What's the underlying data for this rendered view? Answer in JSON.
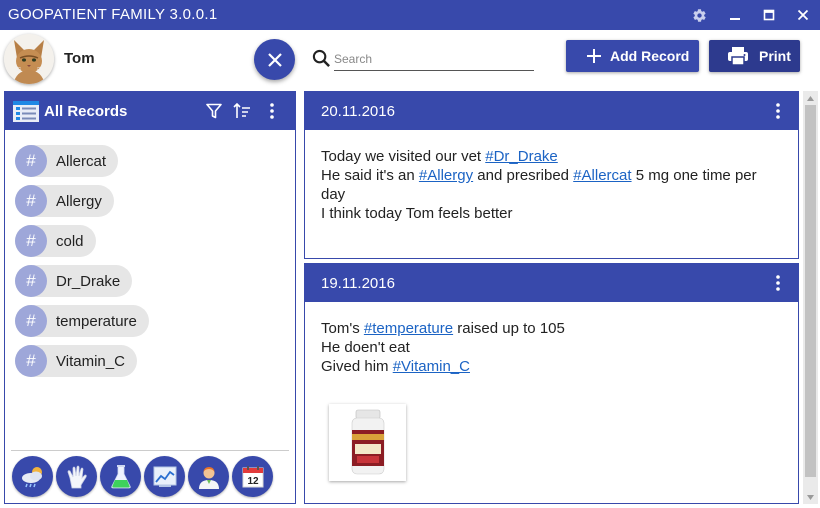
{
  "app": {
    "title": "GOOPATIENT FAMILY 3.0.0.1"
  },
  "window_controls": {
    "settings": "gear-icon",
    "minimize": "minimize-icon",
    "maximize": "maximize-icon",
    "close": "close-icon"
  },
  "header": {
    "username": "Tom",
    "search": {
      "placeholder": "Search",
      "value": ""
    },
    "add_record_label": "Add Record",
    "print_label": "Print"
  },
  "sidebar": {
    "title": "All Records",
    "tags": [
      {
        "label": "Allercat"
      },
      {
        "label": "Allergy"
      },
      {
        "label": "cold"
      },
      {
        "label": "Dr_Drake"
      },
      {
        "label": "temperature"
      },
      {
        "label": "Vitamin_C"
      }
    ],
    "tag_symbol": "#",
    "tools": [
      "weather-icon",
      "glove-icon",
      "flask-icon",
      "chart-icon",
      "doctor-icon",
      "calendar-icon"
    ],
    "calendar_day": "12"
  },
  "records": [
    {
      "date": "20.11.2016",
      "lines": [
        [
          {
            "t": "Today we visited our vet "
          },
          {
            "t": "#Dr_Drake",
            "link": true
          }
        ],
        [
          {
            "t": "He said it's an "
          },
          {
            "t": "#Allergy",
            "link": true
          },
          {
            "t": " and presribed "
          },
          {
            "t": "#Allercat",
            "link": true
          },
          {
            "t": " 5 mg one time per day"
          }
        ],
        [
          {
            "t": "I think today Tom feels better"
          }
        ]
      ]
    },
    {
      "date": "19.11.2016",
      "lines": [
        [
          {
            "t": "Tom's "
          },
          {
            "t": "#temperature",
            "link": true
          },
          {
            "t": " raised up to 105"
          }
        ],
        [
          {
            "t": "He doen't eat"
          }
        ],
        [
          {
            "t": "Gived him "
          },
          {
            "t": "#Vitamin_C",
            "link": true
          }
        ]
      ],
      "attachment": "vitamin-bottle-thumbnail"
    }
  ],
  "colors": {
    "primary": "#3849ab",
    "tag_bg": "#e6e6e6",
    "tag_hash": "#9ea7d9",
    "link": "#1b63c4"
  }
}
